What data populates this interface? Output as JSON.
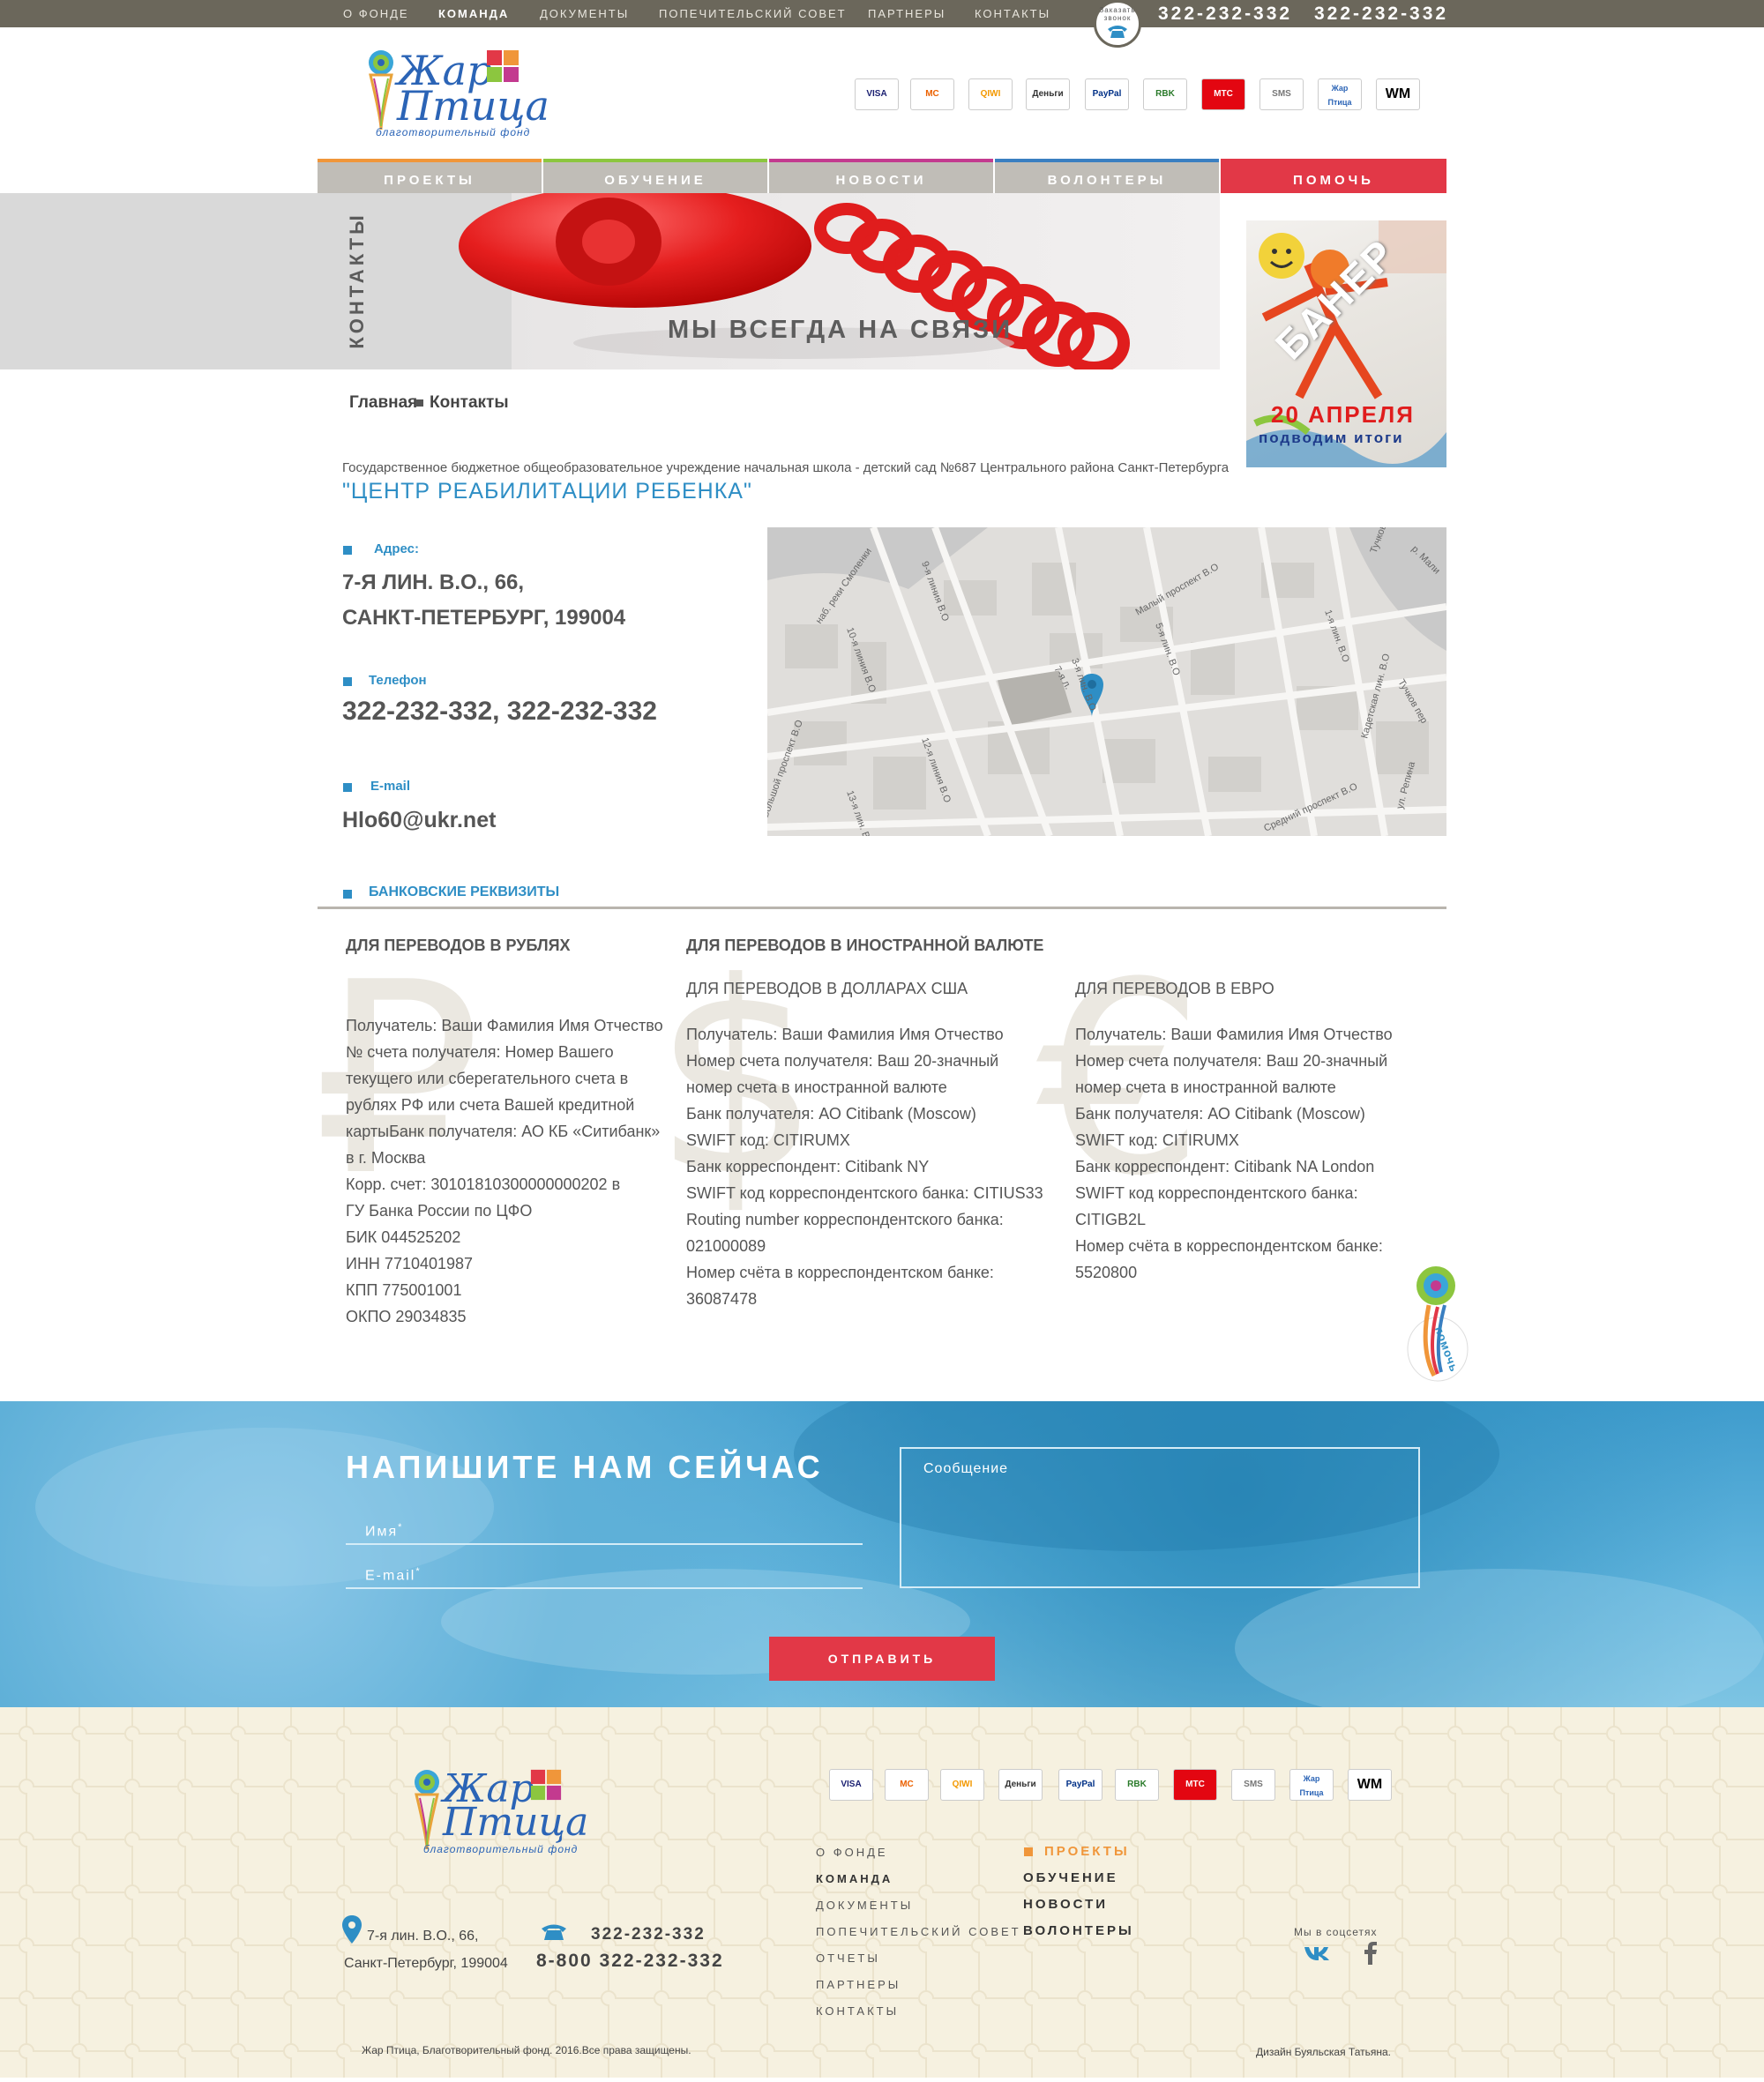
{
  "top_nav": [
    "О ФОНДЕ",
    "КОМАНДА",
    "ДОКУМЕНТЫ",
    "ПОПЕЧИТЕЛЬСКИЙ СОВЕТ",
    "ПАРТНЕРЫ",
    "КОНТАКТЫ"
  ],
  "callback_label": "Заказать звонок",
  "top_phones": [
    "322-232-332",
    "322-232-332"
  ],
  "logo": {
    "line1": "Жар",
    "line2": "Птица",
    "sub": "благотворительный фонд"
  },
  "pay_icons": [
    "VISA",
    "МС",
    "QIWI",
    "Деньги",
    "PayPal",
    "RBK",
    "МТС",
    "SMS",
    "Жар Птица",
    "WM"
  ],
  "main_nav": [
    {
      "label": "ПРОЕКТЫ",
      "color": "#f0963a"
    },
    {
      "label": "ОБУЧЕНИЕ",
      "color": "#8cc63f"
    },
    {
      "label": "НОВОСТИ",
      "color": "#c33a8f"
    },
    {
      "label": "ВОЛОНТЕРЫ",
      "color": "#3a7fc1"
    },
    {
      "label": "ПОМОЧЬ",
      "color": "#e23847"
    }
  ],
  "hero": {
    "side_title": "КОНТАКТЫ",
    "caption": "МЫ ВСЕГДА НА СВЯЗИ"
  },
  "banner": {
    "title": "БАНЕР",
    "date": "20 АПРЕЛЯ",
    "sub": "подводим итоги"
  },
  "breadcrumb": [
    "Главная",
    "Контакты"
  ],
  "org": {
    "desc": "Государственное бюджетное общеобразовательное учреждение начальная школа - детский сад №687 Центрального района Санкт-Петербурга",
    "name": "\"ЦЕНТР РЕАБИЛИТАЦИИ РЕБЕНКА\""
  },
  "contacts": {
    "address_label": "Адрес:",
    "address_line1": "7-Я ЛИН. В.О.,  66,",
    "address_line2": "САНКТ-ПЕТЕРБУРГ,  199004",
    "phone_label": "Телефон",
    "phone_value": "322-232-332,  322-232-332",
    "email_label": "E-mail",
    "email_value": "Hlo60@ukr.net"
  },
  "map_labels": [
    "наб. реки Смоленки",
    "9-я линия В.О",
    "Малый проспект В.О",
    "5-я лин. В.О",
    "3-я лин. В.О",
    "10-я линия В.О",
    "12-я линия В.О",
    "13-я лин. В.О",
    "Средний проспект В.О",
    "Кадетская лин. В.О",
    "Тучков пер",
    "1-я лин. В.О",
    "Тучков пер",
    "ул. Репина",
    "р. Мали",
    "Большой проспект В.О",
    "7-я л."
  ],
  "bank": {
    "section_title": "БАНКОВСКИЕ РЕКВИЗИТЫ",
    "rub_title": "ДЛЯ ПЕРЕВОДОВ В РУБЛЯХ",
    "foreign_title": "ДЛЯ ПЕРЕВОДОВ В ИНОСТРАННОЙ ВАЛЮТЕ",
    "usd_title": "ДЛЯ ПЕРЕВОДОВ В ДОЛЛАРАХ США",
    "eur_title": "ДЛЯ ПЕРЕВОДОВ В ЕВРО",
    "symbols": [
      "₽",
      "$",
      "€"
    ],
    "rub_lines": [
      "Получатель: Ваши Фамилия Имя Отчество",
      "№ счета получателя: Номер Вашего",
      "текущего или сберегательного счета в",
      "рублях РФ или счета Вашей кредитной",
      "картыБанк получателя: АО КБ «Ситибанк»",
      "в г. Москва",
      "Корр. счет: 30101810300000000202 в",
      "ГУ Банка России по ЦФО",
      "БИК 044525202",
      "ИНН 7710401987",
      "КПП 775001001",
      "ОКПО 29034835"
    ],
    "usd_lines": [
      "Получатель: Ваши Фамилия Имя Отчество",
      "Номер счета получателя: Ваш 20-значный",
      "номер счета в иностранной валюте",
      "Банк получателя: АО Citibank (Moscow)",
      "SWIFT код: CITIRUMX",
      "Банк корреспондент: Citibank NY",
      "SWIFT код корреспондентского банка: CITIUS33",
      "Routing number корреспондентского банка:",
      "021000089",
      "Номер счёта в корреспондентском банке:",
      "36087478"
    ],
    "eur_lines": [
      "Получатель: Ваши Фамилия Имя Отчество",
      "Номер счета получателя: Ваш 20-значный",
      "номер счета в иностранной валюте",
      "Банк получателя: АО Citibank (Moscow)",
      "SWIFT код: CITIRUMX",
      "Банк корреспондент: Citibank NA London",
      "SWIFT код корреспондентского банка:",
      "CITIGB2L",
      "Номер счёта в корреспондентском банке:",
      "5520800"
    ]
  },
  "help_badge": "помочь",
  "form": {
    "title": "НАПИШИТЕ НАМ СЕЙЧАС",
    "name_placeholder": "Имя",
    "email_placeholder": "E-mail",
    "required_mark": "*",
    "message_placeholder": "Сообщение",
    "submit_label": "ОТПРАВИТЬ"
  },
  "footer": {
    "nav_left": [
      "О ФОНДЕ",
      "КОМАНДА",
      "ДОКУМЕНТЫ",
      "ПОПЕЧИТЕЛЬСКИЙ СОВЕТ",
      "ОТЧЕТЫ",
      "ПАРТНЕРЫ",
      "КОНТАКТЫ"
    ],
    "nav_right": [
      "ПРОЕКТЫ",
      "ОБУЧЕНИЕ",
      "НОВОСТИ",
      "ВОЛОНТЕРЫ"
    ],
    "address_line1": "7-я лин. В.О., 66,",
    "address_line2": "Санкт-Петербург, 199004",
    "phone1": "322-232-332",
    "phone2": "8-800 322-232-332",
    "social_label": "Мы в соцсетях",
    "copyright": "Жар Птица, Благотворительный фонд. 2016.Все права защищены.",
    "design": "Дизайн Буяльская Татьяна."
  },
  "colors": {
    "accent_blue": "#2e8ec5",
    "accent_red": "#e23847",
    "topbar": "#6b675b",
    "footer_bg": "#f6f1e0"
  }
}
